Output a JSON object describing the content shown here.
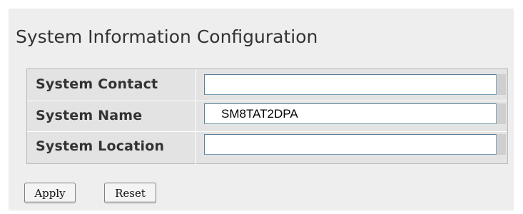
{
  "page": {
    "title": "System Information Configuration"
  },
  "form": {
    "fields": [
      {
        "label": "System Contact",
        "value": "",
        "placeholder": ""
      },
      {
        "label": "System Name",
        "value": "SM8TAT2DPA",
        "placeholder": ""
      },
      {
        "label": "System Location",
        "value": "",
        "placeholder": ""
      }
    ]
  },
  "buttons": {
    "apply_label": "Apply",
    "reset_label": "Reset"
  },
  "colors": {
    "panel_background": "#eeeeee",
    "table_background": "#e3e3e3",
    "text": "#333333"
  }
}
